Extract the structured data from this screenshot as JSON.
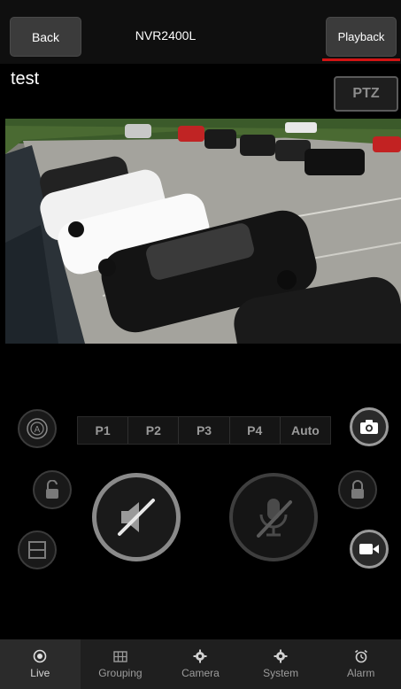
{
  "header": {
    "back_label": "Back",
    "title": "NVR2400L",
    "playback_label": "Playback"
  },
  "channel": {
    "name": "test",
    "ptz_label": "PTZ"
  },
  "controls": {
    "presets": [
      "P1",
      "P2",
      "P3",
      "P4",
      "Auto"
    ],
    "icons": {
      "auto-iris": "auto-iris-icon",
      "snapshot": "camera-icon",
      "unlock": "unlock-icon",
      "lock": "lock-icon",
      "layout": "split-layout-icon",
      "record": "video-record-icon",
      "audio": "speaker-muted-icon",
      "talk": "microphone-muted-icon"
    }
  },
  "bottom_nav": {
    "items": [
      {
        "label": "Live",
        "icon": "live-icon",
        "active": true
      },
      {
        "label": "Grouping",
        "icon": "grouping-icon",
        "active": false
      },
      {
        "label": "Camera",
        "icon": "gear-icon",
        "active": false
      },
      {
        "label": "System",
        "icon": "gear-icon",
        "active": false
      },
      {
        "label": "Alarm",
        "icon": "alarm-clock-icon",
        "active": false
      }
    ]
  },
  "colors": {
    "accent": "#d21414",
    "bar_background": "#1f1f1f",
    "button_background": "#3b3b3b"
  }
}
